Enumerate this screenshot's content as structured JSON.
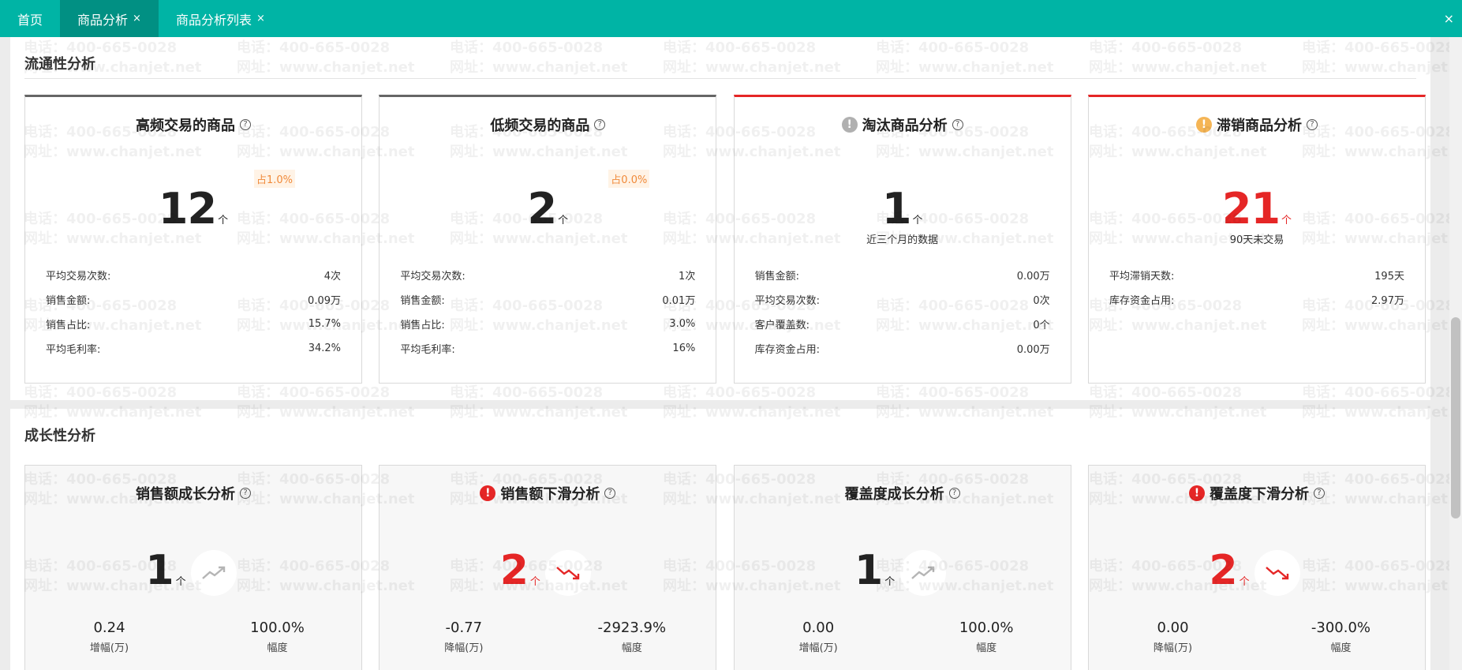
{
  "tabs": [
    {
      "label": "首页",
      "closable": false,
      "active": false
    },
    {
      "label": "商品分析",
      "closable": true,
      "active": true
    },
    {
      "label": "商品分析列表",
      "closable": true,
      "active": false
    }
  ],
  "close_all": "×",
  "close_glyph": "×",
  "watermark": {
    "phone": "电话：400-665-0028",
    "url": "网址：www.chanjet.net"
  },
  "liquidity": {
    "title": "流通性分析",
    "cards": [
      {
        "title": "高频交易的商品",
        "badge": "占1.0%",
        "value": "12",
        "unit": "个",
        "stats": [
          {
            "label": "平均交易次数:",
            "value": "4次"
          },
          {
            "label": "销售金额:",
            "value": "0.09万"
          },
          {
            "label": "销售占比:",
            "value": "15.7%"
          },
          {
            "label": "平均毛利率:",
            "value": "34.2%"
          }
        ]
      },
      {
        "title": "低频交易的商品",
        "badge": "占0.0%",
        "value": "2",
        "unit": "个",
        "stats": [
          {
            "label": "平均交易次数:",
            "value": "1次"
          },
          {
            "label": "销售金额:",
            "value": "0.01万"
          },
          {
            "label": "销售占比:",
            "value": "3.0%"
          },
          {
            "label": "平均毛利率:",
            "value": "16%"
          }
        ]
      },
      {
        "title": "淘汰商品分析",
        "note": "近三个月的数据",
        "value": "1",
        "unit": "个",
        "stats": [
          {
            "label": "销售金额:",
            "value": "0.00万"
          },
          {
            "label": "平均交易次数:",
            "value": "0次"
          },
          {
            "label": "客户覆盖数:",
            "value": "0个"
          },
          {
            "label": "库存资金占用:",
            "value": "0.00万"
          }
        ]
      },
      {
        "title": "滞销商品分析",
        "note": "90天未交易",
        "value": "21",
        "unit": "个",
        "stats": [
          {
            "label": "平均滞销天数:",
            "value": "195天"
          },
          {
            "label": "库存资金占用:",
            "value": "2.97万"
          }
        ]
      }
    ]
  },
  "growth": {
    "title": "成长性分析",
    "cards": [
      {
        "title": "销售额成长分析",
        "value": "1",
        "unit": "个",
        "left_value": "0.24",
        "left_label": "增幅(万)",
        "right_value": "100.0%",
        "right_label": "幅度"
      },
      {
        "title": "销售额下滑分析",
        "value": "2",
        "unit": "个",
        "left_value": "-0.77",
        "left_label": "降幅(万)",
        "right_value": "-2923.9%",
        "right_label": "幅度"
      },
      {
        "title": "覆盖度成长分析",
        "value": "1",
        "unit": "个",
        "left_value": "0.00",
        "left_label": "增幅(万)",
        "right_value": "100.0%",
        "right_label": "幅度"
      },
      {
        "title": "覆盖度下滑分析",
        "value": "2",
        "unit": "个",
        "left_value": "0.00",
        "left_label": "降幅(万)",
        "right_value": "-300.0%",
        "right_label": "幅度"
      }
    ]
  },
  "icons": {
    "help": "?",
    "warn": "!"
  },
  "colors": {
    "brand": "#00b4a5",
    "brand_dark": "#019083",
    "alert": "#e52626",
    "warn": "#f5b555",
    "neutral_icon": "#b0b0b0",
    "badge": "#f08a3a"
  }
}
